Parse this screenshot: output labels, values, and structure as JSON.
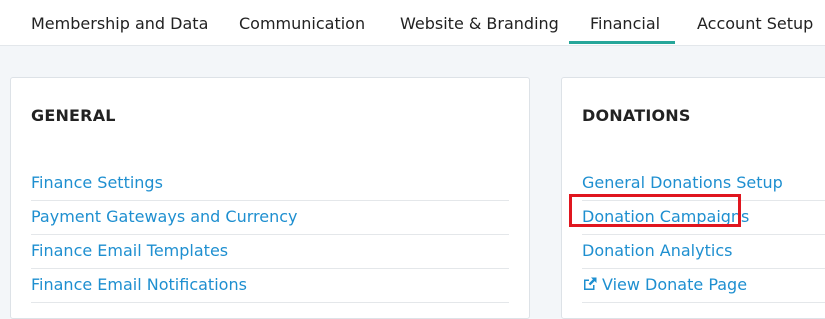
{
  "tabs": [
    {
      "label": "Membership and Data"
    },
    {
      "label": "Communication"
    },
    {
      "label": "Website & Branding"
    },
    {
      "label": "Financial",
      "active": true
    },
    {
      "label": "Account Setup"
    }
  ],
  "colors": {
    "link": "#1e8fd0",
    "active_tab_underline": "#26a69a",
    "highlight": "#e0161f"
  },
  "general": {
    "title": "GENERAL",
    "links": [
      {
        "label": "Finance Settings"
      },
      {
        "label": "Payment Gateways and Currency"
      },
      {
        "label": "Finance Email Templates"
      },
      {
        "label": "Finance Email Notifications"
      }
    ]
  },
  "donations": {
    "title": "DONATIONS",
    "links": [
      {
        "label": "General Donations Setup"
      },
      {
        "label": "Donation Campaigns",
        "highlighted": true
      },
      {
        "label": "Donation Analytics"
      },
      {
        "label": "View Donate Page",
        "icon": "external-link-icon"
      }
    ]
  }
}
